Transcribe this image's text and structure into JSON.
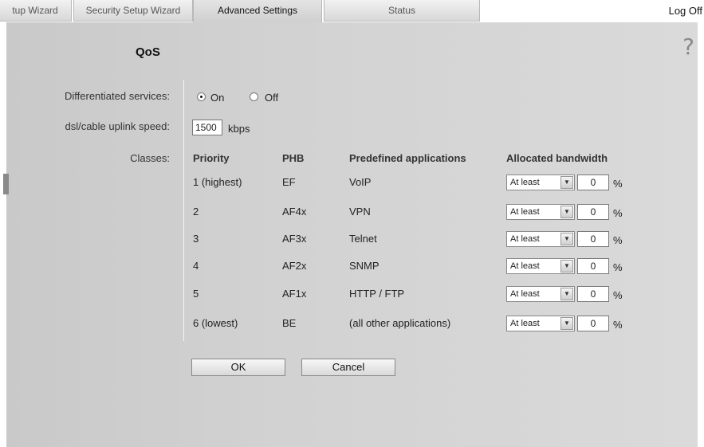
{
  "tabs": [
    {
      "label": "tup Wizard"
    },
    {
      "label": "Security Setup Wizard"
    },
    {
      "label": "Advanced Settings"
    },
    {
      "label": "Status"
    }
  ],
  "logoff": "Log Off",
  "help": "?",
  "title": "QoS",
  "diffserv": {
    "label": "Differentiated services:",
    "on": "On",
    "off": "Off"
  },
  "uplink": {
    "label": "dsl/cable uplink speed:",
    "value": "1500",
    "unit": "kbps"
  },
  "classes": {
    "label": "Classes:",
    "headers": {
      "priority": "Priority",
      "phb": "PHB",
      "apps": "Predefined applications",
      "bandwidth": "Allocated bandwidth"
    },
    "rows": [
      {
        "priority": "1 (highest)",
        "phb": "EF",
        "app": "VoIP",
        "mode": "At least",
        "value": "0",
        "unit": "%"
      },
      {
        "priority": "2",
        "phb": "AF4x",
        "app": "VPN",
        "mode": "At least",
        "value": "0",
        "unit": "%"
      },
      {
        "priority": "3",
        "phb": "AF3x",
        "app": "Telnet",
        "mode": "At least",
        "value": "0",
        "unit": "%"
      },
      {
        "priority": "4",
        "phb": "AF2x",
        "app": "SNMP",
        "mode": "At least",
        "value": "0",
        "unit": "%"
      },
      {
        "priority": "5",
        "phb": "AF1x",
        "app": "HTTP / FTP",
        "mode": "At least",
        "value": "0",
        "unit": "%"
      },
      {
        "priority": "6 (lowest)",
        "phb": "BE",
        "app": "(all other applications)",
        "mode": "At least",
        "value": "0",
        "unit": "%"
      }
    ]
  },
  "buttons": {
    "ok": "OK",
    "cancel": "Cancel"
  }
}
